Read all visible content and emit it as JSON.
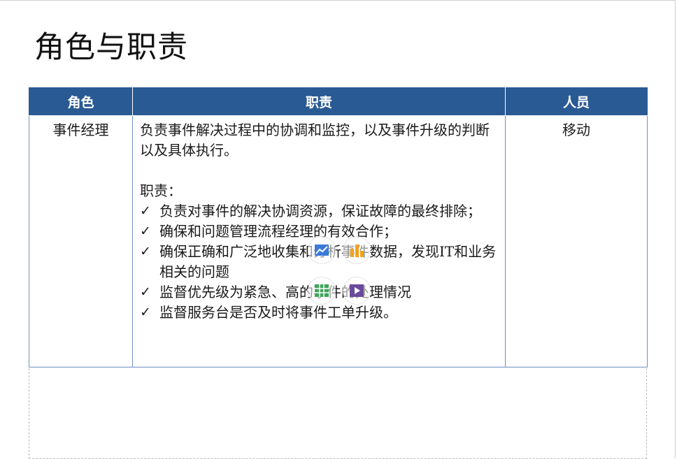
{
  "slide": {
    "title": "角色与职责"
  },
  "table": {
    "headers": [
      "角色",
      "职责",
      "人员"
    ],
    "row": {
      "role": "事件经理",
      "responsibility_intro": "负责事件解决过程中的协调和监控，以及事件升级的判断以及具体执行。",
      "responsibility_heading": "职责：",
      "responsibility_items": [
        "负责对事件的解决协调资源，保证故障的最终排除；",
        "确保和问题管理流程经理的有效合作；",
        "确保正确和广泛地收集和分析事件数据，发现IT和业务相关的问题",
        "监督优先级为紧急、高的事件的处理情况",
        "监督服务台是否及时将事件工单升级。"
      ],
      "person": "移动"
    }
  },
  "bullet_glyph": "✓",
  "insert_icons": [
    "insert-chart-icon",
    "insert-bar-chart-icon",
    "insert-table-icon",
    "insert-video-icon"
  ],
  "colors": {
    "header_bg": "#2a5a93",
    "header_text": "#ffffff",
    "grid": "#6f8fc4"
  }
}
